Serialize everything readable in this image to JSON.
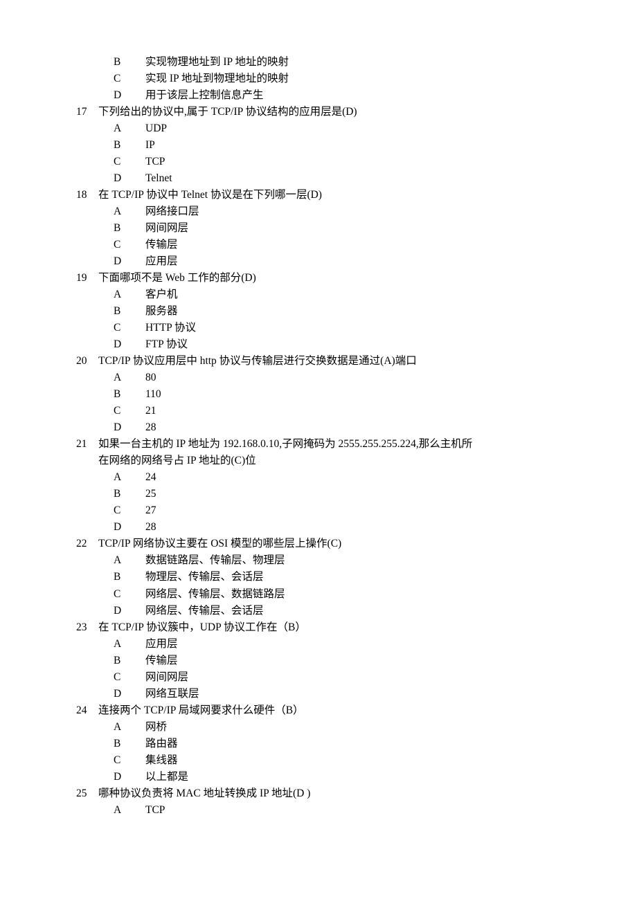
{
  "continuation_options": [
    {
      "label": "B",
      "text": "实现物理地址到 IP 地址的映射"
    },
    {
      "label": "C",
      "text": "实现 IP 地址到物理地址的映射"
    },
    {
      "label": "D",
      "text": "用于该层上控制信息产生"
    }
  ],
  "questions": [
    {
      "num": "17",
      "text": "下列给出的协议中,属于 TCP/IP 协议结构的应用层是(D)",
      "options": [
        {
          "label": "A",
          "text": "UDP"
        },
        {
          "label": "B",
          "text": "IP"
        },
        {
          "label": "C",
          "text": "TCP"
        },
        {
          "label": "D",
          "text": "Telnet"
        }
      ]
    },
    {
      "num": "18",
      "text": "在 TCP/IP 协议中 Telnet 协议是在下列哪一层(D)",
      "options": [
        {
          "label": "A",
          "text": "网络接口层"
        },
        {
          "label": "B",
          "text": "网间网层"
        },
        {
          "label": "C",
          "text": "传输层"
        },
        {
          "label": "D",
          "text": "应用层"
        }
      ]
    },
    {
      "num": "19",
      "text": "下面哪项不是 Web 工作的部分(D)",
      "options": [
        {
          "label": "A",
          "text": "客户机"
        },
        {
          "label": "B",
          "text": "服务器"
        },
        {
          "label": "C",
          "text": "HTTP 协议"
        },
        {
          "label": "D",
          "text": "FTP 协议"
        }
      ]
    },
    {
      "num": "20",
      "text": "TCP/IP 协议应用层中 http 协议与传输层进行交换数据是通过(A)端口",
      "options": [
        {
          "label": "A",
          "text": "80"
        },
        {
          "label": "B",
          "text": "110"
        },
        {
          "label": "C",
          "text": "21"
        },
        {
          "label": "D",
          "text": "28"
        }
      ]
    },
    {
      "num": "21",
      "text": "如果一台主机的 IP 地址为 192.168.0.10,子网掩码为 2555.255.255.224,那么主机所",
      "text_cont": "在网络的网络号占 IP 地址的(C)位",
      "options": [
        {
          "label": "A",
          "text": "24"
        },
        {
          "label": "B",
          "text": "25"
        },
        {
          "label": "C",
          "text": "27"
        },
        {
          "label": "D",
          "text": "28"
        }
      ]
    },
    {
      "num": "22",
      "text": "TCP/IP 网络协议主要在 OSI 模型的哪些层上操作(C)",
      "options": [
        {
          "label": "A",
          "text": "数据链路层、传输层、物理层"
        },
        {
          "label": "B",
          "text": "物理层、传输层、会话层"
        },
        {
          "label": "C",
          "text": "网络层、传输层、数据链路层"
        },
        {
          "label": "D",
          "text": "网络层、传输层、会话层"
        }
      ]
    },
    {
      "num": "23",
      "text": "在 TCP/IP 协议簇中，UDP 协议工作在（B）",
      "options": [
        {
          "label": "A",
          "text": "应用层"
        },
        {
          "label": "B",
          "text": "传输层"
        },
        {
          "label": "C",
          "text": "网间网层"
        },
        {
          "label": "D",
          "text": "网络互联层"
        }
      ]
    },
    {
      "num": "24",
      "text": "连接两个 TCP/IP 局域网要求什么硬件（B）",
      "options": [
        {
          "label": "A",
          "text": "网桥"
        },
        {
          "label": "B",
          "text": "路由器"
        },
        {
          "label": "C",
          "text": "集线器"
        },
        {
          "label": "D",
          "text": "以上都是"
        }
      ]
    },
    {
      "num": "25",
      "text": "哪种协议负责将 MAC 地址转换成 IP 地址(D )",
      "options": [
        {
          "label": "A",
          "text": "TCP"
        }
      ]
    }
  ]
}
